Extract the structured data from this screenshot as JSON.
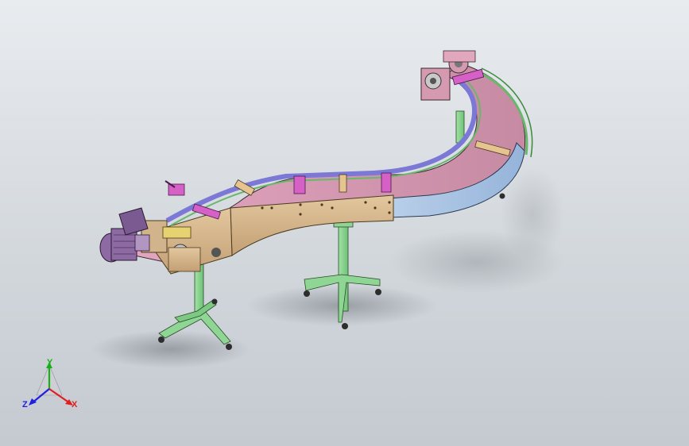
{
  "axis_triad": {
    "x_label": "X",
    "y_label": "Y",
    "z_label": "Z"
  },
  "colors": {
    "background_top": "#e9ecef",
    "background_bottom": "#c4cad0",
    "frame_tan": "#d2b48c",
    "frame_pink": "#d69ab0",
    "frame_blue": "#a9c4e4",
    "rail_violet": "#7b78d6",
    "rail_green": "#69b76a",
    "stand_green": "#8fd694",
    "bracket_magenta": "#d560c6",
    "motor_violet": "#8d6aa3",
    "axis_x": "#e02020",
    "axis_y": "#18b018",
    "axis_z": "#2020e0"
  },
  "model": {
    "name_visible": false
  }
}
